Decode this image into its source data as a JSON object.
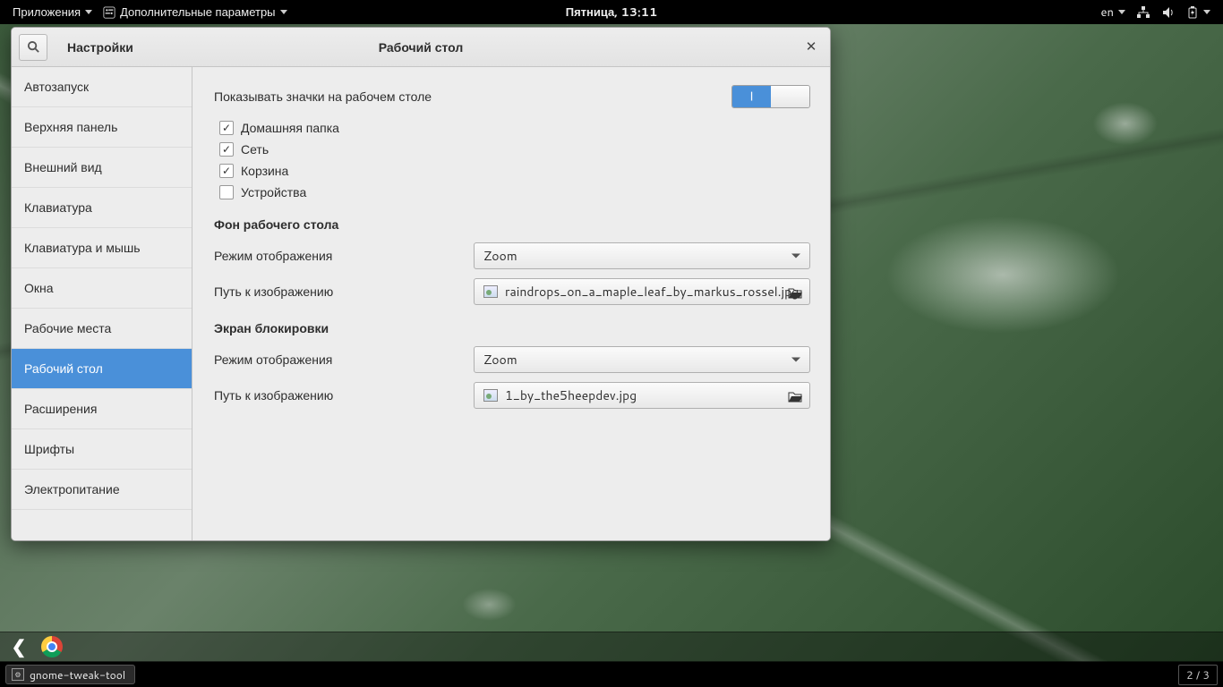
{
  "topbar": {
    "applications": "Приложения",
    "tweak_launcher": "Дополнительные параметры",
    "clock": "Пятница, 13:11",
    "lang": "en"
  },
  "window": {
    "settings_label": "Настройки",
    "title": "Рабочий стол"
  },
  "sidebar": {
    "items": [
      "Автозапуск",
      "Верхняя панель",
      "Внешний вид",
      "Клавиатура",
      "Клавиатура и мышь",
      "Окна",
      "Рабочие места",
      "Рабочий стол",
      "Расширения",
      "Шрифты",
      "Электропитание"
    ],
    "selected_index": 7
  },
  "content": {
    "show_icons_label": "Показывать значки на рабочем столе",
    "switch_on_glyph": "|",
    "checkboxes": [
      {
        "label": "Домашняя папка",
        "checked": true
      },
      {
        "label": "Сеть",
        "checked": true
      },
      {
        "label": "Корзина",
        "checked": true
      },
      {
        "label": "Устройства",
        "checked": false
      }
    ],
    "bg_section": "Фон рабочего стола",
    "mode_label": "Режим отображения",
    "mode_value": "Zoom",
    "path_label": "Путь к изображению",
    "bg_file": "raindrops_on_a_maple_leaf_by_markus_rossel.jpg",
    "lock_section": "Экран блокировки",
    "lock_mode_value": "Zoom",
    "lock_file": "1_by_the5heepdev.jpg"
  },
  "taskbar": {
    "task_label": "gnome-tweak-tool",
    "workspace": "2 / 3"
  }
}
